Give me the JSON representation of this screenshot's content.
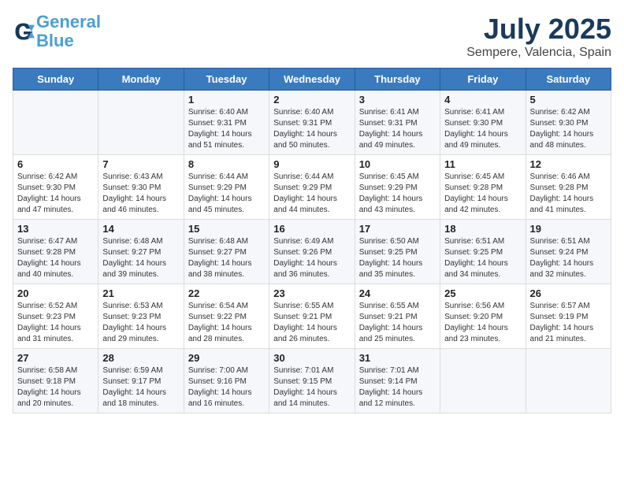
{
  "header": {
    "logo_line1": "General",
    "logo_line2": "Blue",
    "month": "July 2025",
    "location": "Sempere, Valencia, Spain"
  },
  "weekdays": [
    "Sunday",
    "Monday",
    "Tuesday",
    "Wednesday",
    "Thursday",
    "Friday",
    "Saturday"
  ],
  "weeks": [
    [
      {
        "day": "",
        "info": ""
      },
      {
        "day": "",
        "info": ""
      },
      {
        "day": "1",
        "info": "Sunrise: 6:40 AM\nSunset: 9:31 PM\nDaylight: 14 hours and 51 minutes."
      },
      {
        "day": "2",
        "info": "Sunrise: 6:40 AM\nSunset: 9:31 PM\nDaylight: 14 hours and 50 minutes."
      },
      {
        "day": "3",
        "info": "Sunrise: 6:41 AM\nSunset: 9:31 PM\nDaylight: 14 hours and 49 minutes."
      },
      {
        "day": "4",
        "info": "Sunrise: 6:41 AM\nSunset: 9:30 PM\nDaylight: 14 hours and 49 minutes."
      },
      {
        "day": "5",
        "info": "Sunrise: 6:42 AM\nSunset: 9:30 PM\nDaylight: 14 hours and 48 minutes."
      }
    ],
    [
      {
        "day": "6",
        "info": "Sunrise: 6:42 AM\nSunset: 9:30 PM\nDaylight: 14 hours and 47 minutes."
      },
      {
        "day": "7",
        "info": "Sunrise: 6:43 AM\nSunset: 9:30 PM\nDaylight: 14 hours and 46 minutes."
      },
      {
        "day": "8",
        "info": "Sunrise: 6:44 AM\nSunset: 9:29 PM\nDaylight: 14 hours and 45 minutes."
      },
      {
        "day": "9",
        "info": "Sunrise: 6:44 AM\nSunset: 9:29 PM\nDaylight: 14 hours and 44 minutes."
      },
      {
        "day": "10",
        "info": "Sunrise: 6:45 AM\nSunset: 9:29 PM\nDaylight: 14 hours and 43 minutes."
      },
      {
        "day": "11",
        "info": "Sunrise: 6:45 AM\nSunset: 9:28 PM\nDaylight: 14 hours and 42 minutes."
      },
      {
        "day": "12",
        "info": "Sunrise: 6:46 AM\nSunset: 9:28 PM\nDaylight: 14 hours and 41 minutes."
      }
    ],
    [
      {
        "day": "13",
        "info": "Sunrise: 6:47 AM\nSunset: 9:28 PM\nDaylight: 14 hours and 40 minutes."
      },
      {
        "day": "14",
        "info": "Sunrise: 6:48 AM\nSunset: 9:27 PM\nDaylight: 14 hours and 39 minutes."
      },
      {
        "day": "15",
        "info": "Sunrise: 6:48 AM\nSunset: 9:27 PM\nDaylight: 14 hours and 38 minutes."
      },
      {
        "day": "16",
        "info": "Sunrise: 6:49 AM\nSunset: 9:26 PM\nDaylight: 14 hours and 36 minutes."
      },
      {
        "day": "17",
        "info": "Sunrise: 6:50 AM\nSunset: 9:25 PM\nDaylight: 14 hours and 35 minutes."
      },
      {
        "day": "18",
        "info": "Sunrise: 6:51 AM\nSunset: 9:25 PM\nDaylight: 14 hours and 34 minutes."
      },
      {
        "day": "19",
        "info": "Sunrise: 6:51 AM\nSunset: 9:24 PM\nDaylight: 14 hours and 32 minutes."
      }
    ],
    [
      {
        "day": "20",
        "info": "Sunrise: 6:52 AM\nSunset: 9:23 PM\nDaylight: 14 hours and 31 minutes."
      },
      {
        "day": "21",
        "info": "Sunrise: 6:53 AM\nSunset: 9:23 PM\nDaylight: 14 hours and 29 minutes."
      },
      {
        "day": "22",
        "info": "Sunrise: 6:54 AM\nSunset: 9:22 PM\nDaylight: 14 hours and 28 minutes."
      },
      {
        "day": "23",
        "info": "Sunrise: 6:55 AM\nSunset: 9:21 PM\nDaylight: 14 hours and 26 minutes."
      },
      {
        "day": "24",
        "info": "Sunrise: 6:55 AM\nSunset: 9:21 PM\nDaylight: 14 hours and 25 minutes."
      },
      {
        "day": "25",
        "info": "Sunrise: 6:56 AM\nSunset: 9:20 PM\nDaylight: 14 hours and 23 minutes."
      },
      {
        "day": "26",
        "info": "Sunrise: 6:57 AM\nSunset: 9:19 PM\nDaylight: 14 hours and 21 minutes."
      }
    ],
    [
      {
        "day": "27",
        "info": "Sunrise: 6:58 AM\nSunset: 9:18 PM\nDaylight: 14 hours and 20 minutes."
      },
      {
        "day": "28",
        "info": "Sunrise: 6:59 AM\nSunset: 9:17 PM\nDaylight: 14 hours and 18 minutes."
      },
      {
        "day": "29",
        "info": "Sunrise: 7:00 AM\nSunset: 9:16 PM\nDaylight: 14 hours and 16 minutes."
      },
      {
        "day": "30",
        "info": "Sunrise: 7:01 AM\nSunset: 9:15 PM\nDaylight: 14 hours and 14 minutes."
      },
      {
        "day": "31",
        "info": "Sunrise: 7:01 AM\nSunset: 9:14 PM\nDaylight: 14 hours and 12 minutes."
      },
      {
        "day": "",
        "info": ""
      },
      {
        "day": "",
        "info": ""
      }
    ]
  ]
}
